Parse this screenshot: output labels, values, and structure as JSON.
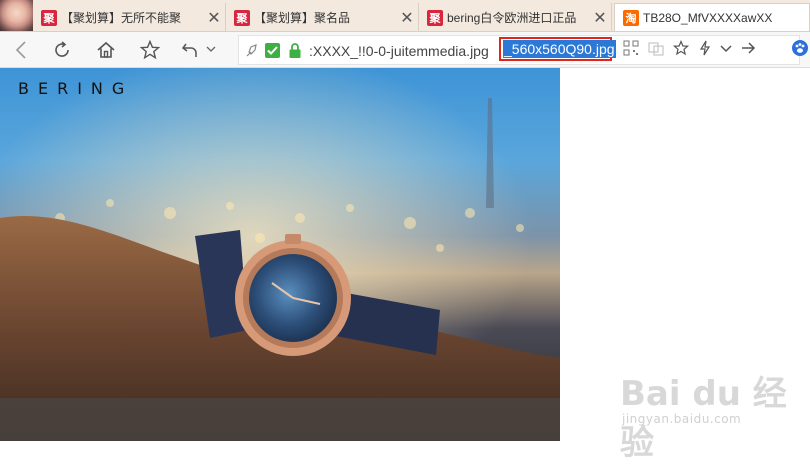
{
  "tabs": [
    {
      "icon": "ju-favicon",
      "favicon_text": "聚",
      "title": "【聚划算】无所不能聚",
      "active": false
    },
    {
      "icon": "ju-favicon",
      "favicon_text": "聚",
      "title": "【聚划算】聚名品",
      "active": false
    },
    {
      "icon": "ju-favicon",
      "favicon_text": "聚",
      "title": "bering白令欧洲进口正品",
      "active": false
    },
    {
      "icon": "taobao-favicon",
      "favicon_text": "淘",
      "title": "TB28O_MfVXXXXawXX",
      "active": true
    }
  ],
  "toolbar": {
    "back_icon": "back-arrow-icon",
    "reload_icon": "reload-icon",
    "home_icon": "home-icon",
    "bookmark_icon": "star-icon",
    "undo_icon": "undo-icon"
  },
  "address": {
    "url_visible": ":XXXX_!!0-0-juitemmedia.jpg",
    "url_selected": "_560x560Q90.jpg"
  },
  "page": {
    "logo": "BERING",
    "watermark_main": "Bai du 经验",
    "watermark_sub": "jingyan.baidu.com"
  },
  "colors": {
    "tabstrip_bg": "#f3e9df",
    "selection": "#2b78d6",
    "highlight_box": "#e0261b"
  }
}
